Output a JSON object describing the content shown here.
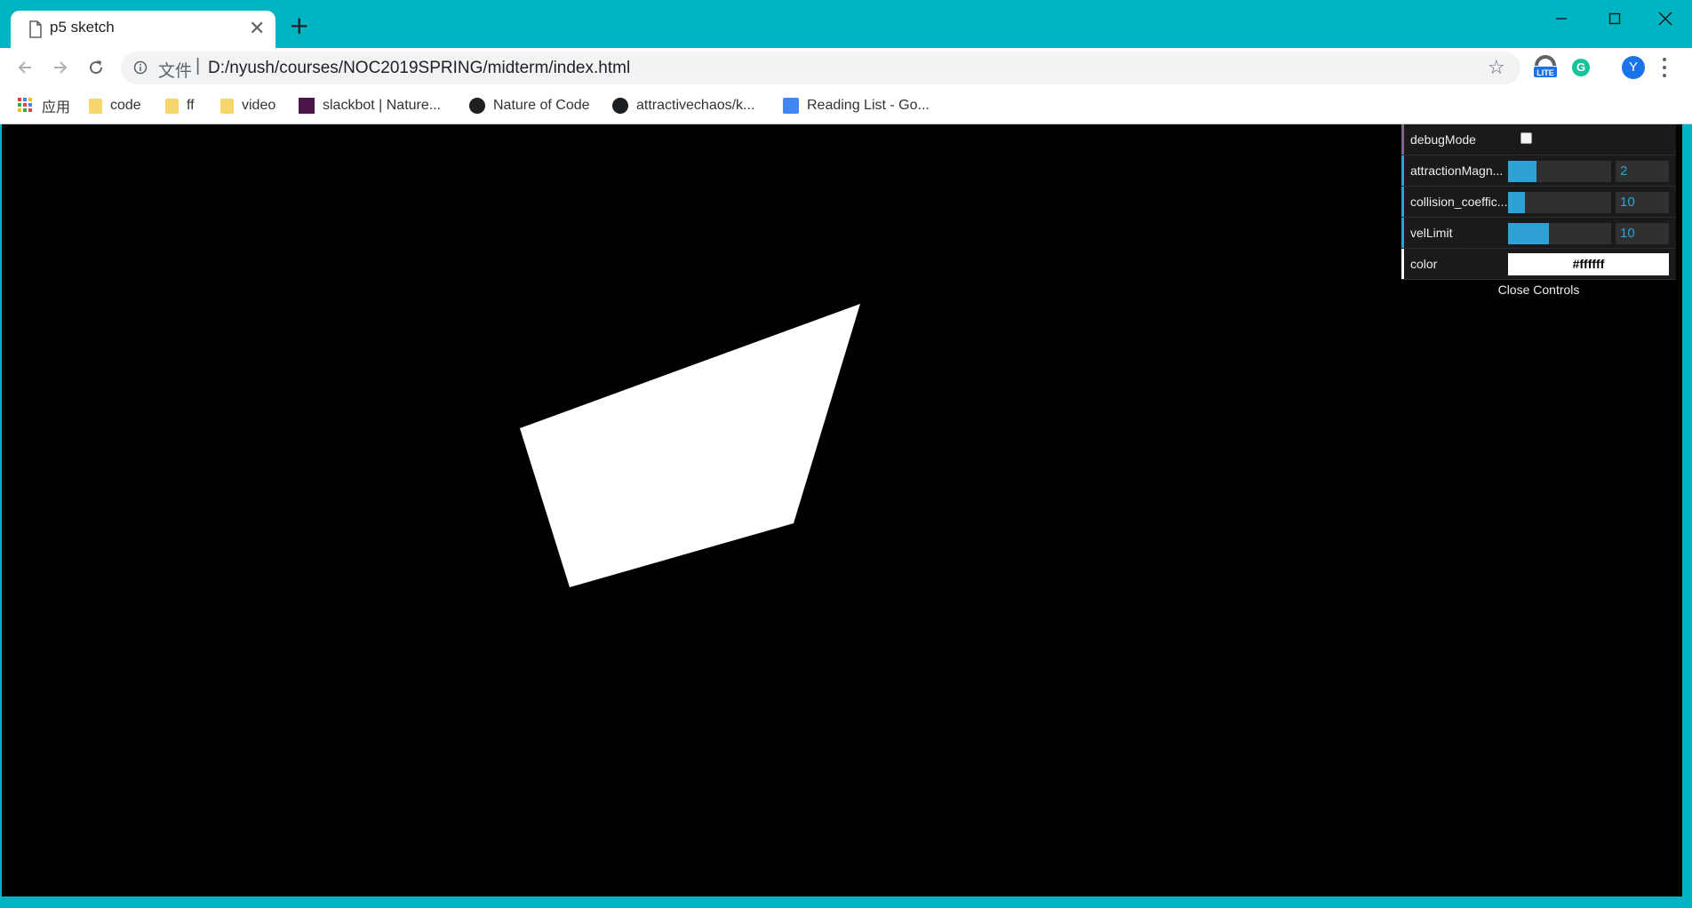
{
  "browser": {
    "tab_title": "p5 sketch",
    "tab_close_glyph": "✕",
    "new_tab_glyph": "+",
    "scheme_label": "文件",
    "url": "D:/nyush/courses/NOC2019SPRING/midterm/index.html",
    "extension_lite_label": "LITE",
    "extension_grammarly_label": "G",
    "profile_initial": "Y",
    "accent_color": "#00b4c4"
  },
  "bookmarks": [
    {
      "label": "应用",
      "icon": "apps-icon"
    },
    {
      "label": "code",
      "icon": "folder-icon"
    },
    {
      "label": "ff",
      "icon": "folder-icon"
    },
    {
      "label": "video",
      "icon": "folder-icon"
    },
    {
      "label": "slackbot | Nature...",
      "icon": "slack-icon"
    },
    {
      "label": "Nature of Code",
      "icon": "noc-icon"
    },
    {
      "label": "attractivechaos/k...",
      "icon": "github-icon"
    },
    {
      "label": "Reading List - Go...",
      "icon": "google-docs-icon"
    }
  ],
  "gui": {
    "controls": [
      {
        "label": "debugMode",
        "type": "checkbox",
        "checked": false,
        "stripe": "#806787"
      },
      {
        "label": "attractionMagn...",
        "type": "slider",
        "value": "2",
        "fill_fraction": 0.28,
        "stripe": "#2fa1d6"
      },
      {
        "label": "collision_coeffic...",
        "type": "slider",
        "value": "10",
        "fill_fraction": 0.16,
        "stripe": "#2fa1d6"
      },
      {
        "label": "velLimit",
        "type": "slider",
        "value": "10",
        "fill_fraction": 0.4,
        "stripe": "#2fa1d6"
      },
      {
        "label": "color",
        "type": "color",
        "value": "#ffffff",
        "stripe": "#ffffff"
      }
    ],
    "close_label": "Close Controls",
    "slider_color": "#2fa1d6"
  },
  "sketch": {
    "background": "#000000",
    "shape_color": "#ffffff"
  }
}
